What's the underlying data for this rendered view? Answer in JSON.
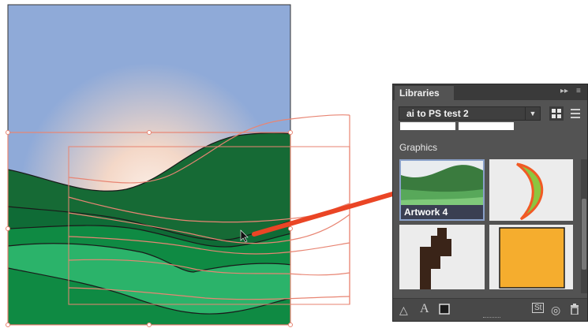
{
  "panel": {
    "tab_label": "Libraries",
    "library_name": "ai to PS test 2",
    "section_label": "Graphics",
    "tiles": [
      {
        "caption": "Artwork 4",
        "selected": true
      },
      {
        "caption": "",
        "selected": false
      },
      {
        "caption": "",
        "selected": false
      },
      {
        "caption": "",
        "selected": false
      }
    ],
    "footer_icons": [
      "add-graphic-icon",
      "add-text-style-icon",
      "add-fill-color-icon",
      "stock-icon",
      "creative-cloud-sync-icon",
      "trash-icon"
    ],
    "footer_stock_text": "St"
  },
  "colors": {
    "sky": "#8faad8",
    "sun_glow": "#f7e4d6",
    "hill_dark": "#166a35",
    "hill_mid": "#0f8a43",
    "hill_light": "#2bb36a",
    "selection": "#e88573",
    "arrow": "#ea4525",
    "panel_bg": "#535353",
    "tile_orange": "#f5ad2e",
    "moon_green": "#8cc63f",
    "moon_outline": "#f15a24"
  }
}
